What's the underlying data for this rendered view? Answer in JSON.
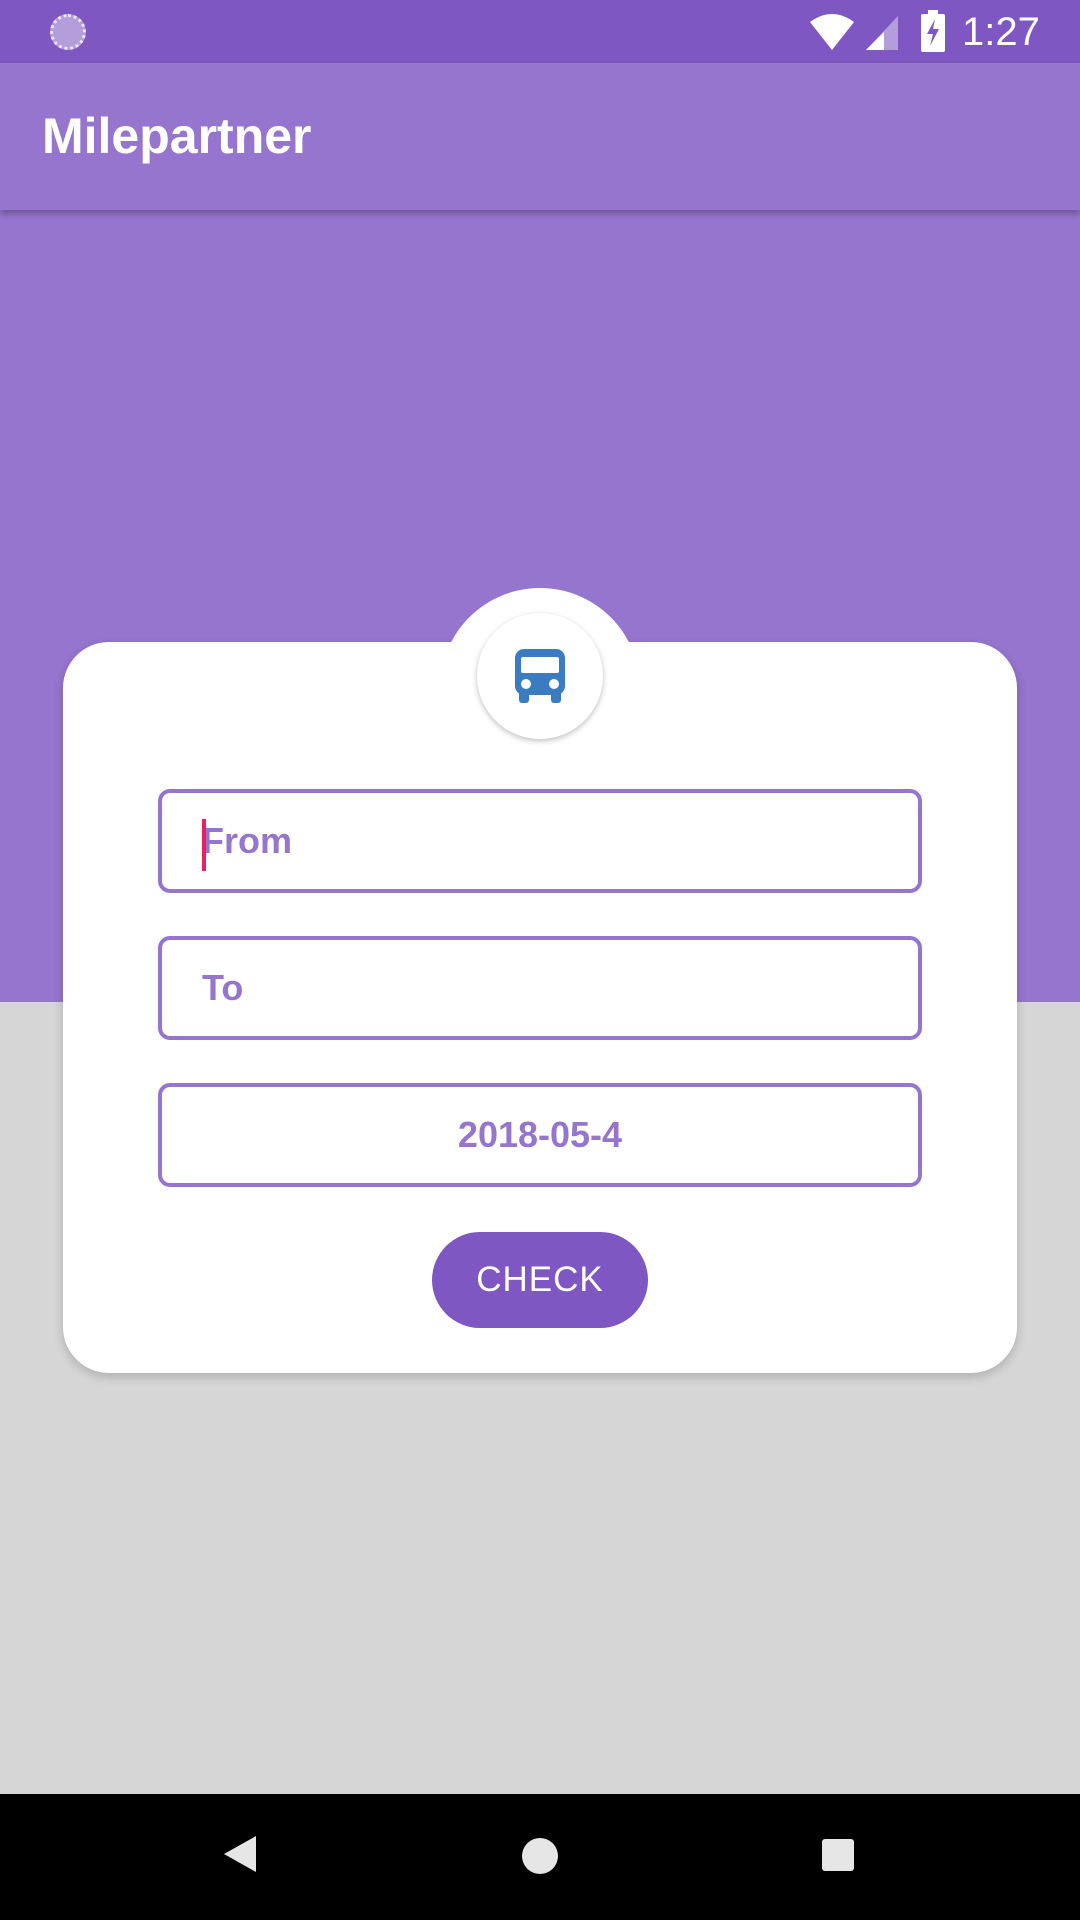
{
  "status_bar": {
    "time": "1:27",
    "icons": [
      "loading-icon",
      "wifi-icon",
      "signal-icon",
      "battery-charging-icon"
    ]
  },
  "app_bar": {
    "title": "Milepartner"
  },
  "search_card": {
    "icon": "bus-icon",
    "from_placeholder": "From",
    "from_value": "",
    "to_placeholder": "To",
    "to_value": "",
    "date": "2018-05-4",
    "check_label": "CHECK"
  },
  "nav_bar": {
    "icons": [
      "back-icon",
      "home-icon",
      "recents-icon"
    ]
  },
  "colors": {
    "primary_dark": "#7e57c2",
    "primary": "#9575cd",
    "bus_icon": "#3b7bbf",
    "cursor": "#e91e63",
    "background": "#d6d6d6"
  }
}
